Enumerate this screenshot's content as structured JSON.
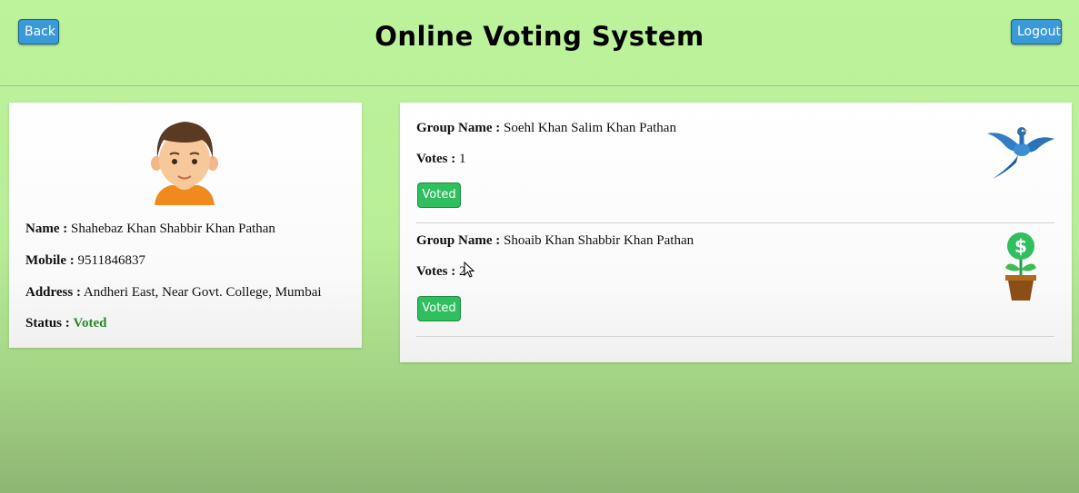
{
  "header": {
    "back_label": "Back",
    "title": "Online Voting System",
    "logout_label": "Logout"
  },
  "profile": {
    "avatar_icon": "user-avatar-icon",
    "name_label": "Name :",
    "name_value": "Shahebaz Khan Shabbir Khan Pathan",
    "mobile_label": "Mobile :",
    "mobile_value": "9511846837",
    "address_label": "Address :",
    "address_value": "Andheri East, Near Govt. College, Mumbai",
    "status_label": "Status :",
    "status_value": "Voted",
    "status_color": "#2a8a2a"
  },
  "groups": [
    {
      "name_label": "Group Name :",
      "name_value": "Soehl Khan Salim Khan Pathan",
      "votes_label": "Votes :",
      "votes_value": "1",
      "button_label": "Voted",
      "icon": "bird-icon"
    },
    {
      "name_label": "Group Name :",
      "name_value": "Shoaib Khan Shabbir Khan Pathan",
      "votes_label": "Votes :",
      "votes_value": "2",
      "button_label": "Voted",
      "icon": "money-plant-icon"
    }
  ],
  "colors": {
    "background": "#bdf39b",
    "header_button": "#3a9ad9",
    "voted_button": "#2fbf5e"
  }
}
